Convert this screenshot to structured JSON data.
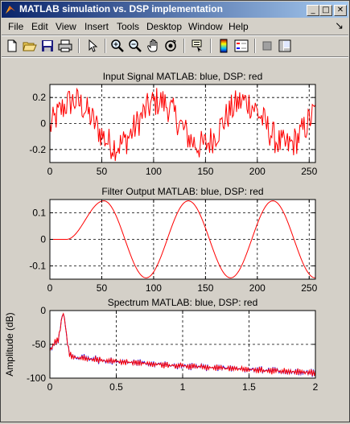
{
  "window": {
    "title": "MATLAB simulation vs. DSP implementation",
    "buttons": {
      "minimize": "_",
      "maximize": "□",
      "close": "✕"
    }
  },
  "menu": {
    "items": [
      "File",
      "Edit",
      "View",
      "Insert",
      "Tools",
      "Desktop",
      "Window",
      "Help"
    ],
    "dock_arrow": "↘"
  },
  "toolbar": {
    "icons": [
      "new-file-icon",
      "open-file-icon",
      "save-icon",
      "print-icon",
      "pointer-icon",
      "zoom-in-icon",
      "zoom-out-icon",
      "pan-hand-icon",
      "rotate-3d-icon",
      "data-cursor-icon",
      "colorbar-icon",
      "legend-icon",
      "hide-plot-tools-icon",
      "show-plot-tools-icon"
    ]
  },
  "colors": {
    "matlab": "#0000ff",
    "dsp": "#ff0000",
    "axes_bg": "#ffffff",
    "figure_bg": "#d4d0c8",
    "titlebar_start": "#0a246a",
    "titlebar_end": "#a6caf0"
  },
  "chart_data": [
    {
      "type": "line",
      "title": "Input Signal       MATLAB: blue,  DSP: red",
      "xlabel": "",
      "ylabel": "",
      "xlim": [
        0,
        256
      ],
      "ylim": [
        -0.3,
        0.3
      ],
      "xticks": [
        0,
        50,
        100,
        150,
        200,
        250
      ],
      "yticks": [
        -0.2,
        0,
        0.2
      ],
      "xtick_labels": [
        "0",
        "50",
        "100",
        "150",
        "200",
        "250"
      ],
      "ytick_labels": [
        "-0.2",
        "0",
        "0.2"
      ],
      "grid": true,
      "signal": {
        "kind": "noisy_sine",
        "amplitude": 0.17,
        "period": 82,
        "phase_deg": -10,
        "noise_amplitude": 0.12,
        "samples": 257
      },
      "series": []
    },
    {
      "type": "line",
      "title": "Filter Output       MATLAB: blue,  DSP: red",
      "xlabel": "",
      "ylabel": "",
      "xlim": [
        0,
        256
      ],
      "ylim": [
        -0.15,
        0.15
      ],
      "xticks": [
        0,
        50,
        100,
        150,
        200,
        250
      ],
      "yticks": [
        -0.1,
        0,
        0.1
      ],
      "xtick_labels": [
        "0",
        "50",
        "100",
        "150",
        "200",
        "250"
      ],
      "ytick_labels": [
        "-0.1",
        "0",
        "0.1"
      ],
      "grid": true,
      "signal": {
        "kind": "delayed_sine",
        "delay": 16,
        "rise_end": 52,
        "amplitude": 0.145,
        "period": 81.5,
        "peaks_at": [
          52,
          133,
          214
        ]
      },
      "series": []
    },
    {
      "type": "line",
      "title": "Spectrum       MATLAB: blue,  DSP: red",
      "xlabel": "",
      "ylabel": "Amplitude (dB)",
      "xlim": [
        0,
        2
      ],
      "ylim": [
        -100,
        0
      ],
      "xticks": [
        0,
        0.5,
        1,
        1.5,
        2
      ],
      "yticks": [
        -100,
        -50,
        0
      ],
      "xtick_labels": [
        "0",
        "0.5",
        "1",
        "1.5",
        "2"
      ],
      "ytick_labels": [
        "-100",
        "-50",
        "0"
      ],
      "grid": true,
      "signal": {
        "kind": "spectrum",
        "peak_freq": 0.1,
        "peak_db": -5,
        "floor_start_db": -62,
        "floor_end_db": -92,
        "ripple_db": 4
      },
      "series": []
    }
  ]
}
